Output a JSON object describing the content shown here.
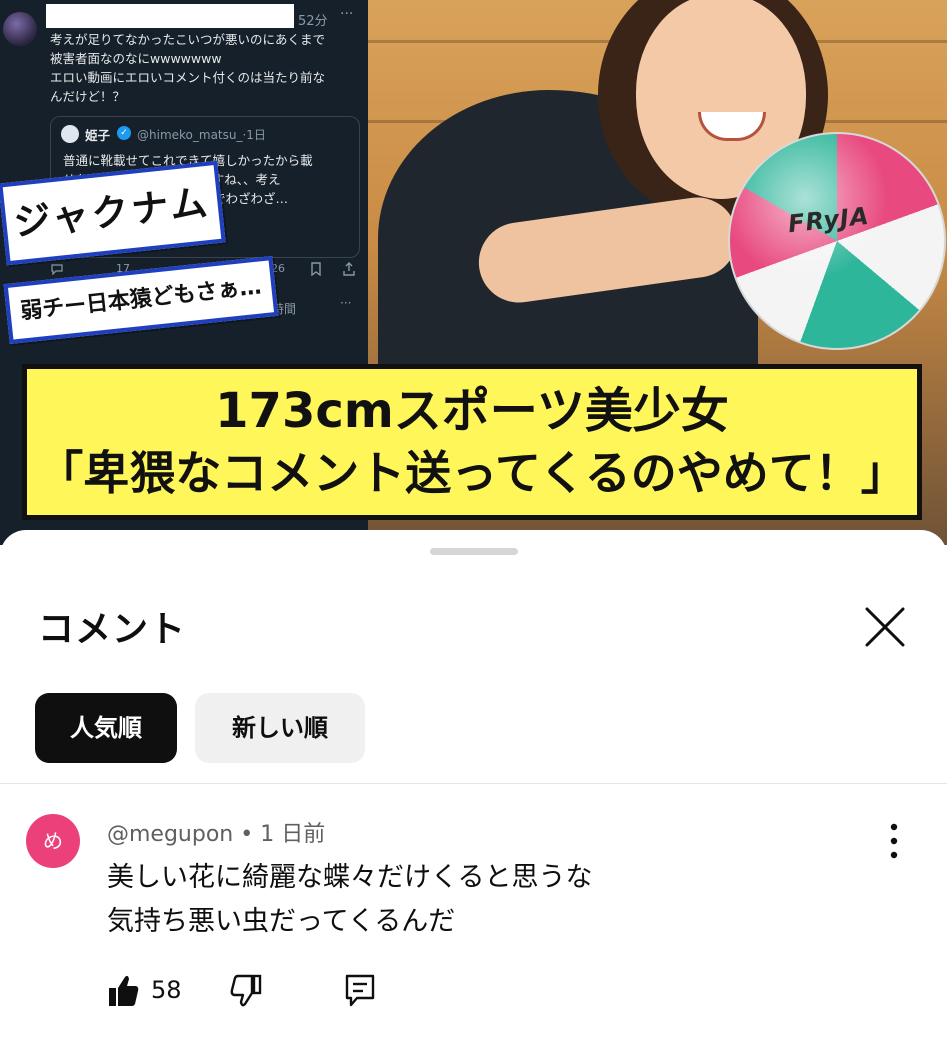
{
  "thumbnail": {
    "tweet": {
      "time": "52分",
      "more": "···",
      "lines": [
        "考えが足りてなかったこいつが悪いのにあくまで",
        "被害者面なのなにwwwwwww",
        "エロい動画にエロいコメント付くのは当たり前な",
        "んだけど！？"
      ],
      "quote": {
        "name": "姫子",
        "handle": "@himeko_matsu_·1日",
        "lines": [
          "普通に靴載せてこれできて嬉しかったから載",
          "せたけど違う…　　ってますね、、考え",
          "",
          "",
          "　　　　　　　　　てるのでわざわざ…"
        ]
      },
      "actions": [
        "17",
        "126"
      ],
      "faded_text": "時間"
    },
    "ball_text": "FRyJA",
    "tag_large": "ジャクナム",
    "tag_small": "弱チー日本猿どもさぁ…",
    "banner_line1": "173cmスポーツ美少女",
    "banner_line2": "「卑猥なコメント送ってくるのやめて！」"
  },
  "sheet": {
    "title": "コメント",
    "chips": [
      "人気順",
      "新しい順"
    ],
    "close_icon": "close-icon"
  },
  "comment": {
    "avatar_letter": "め",
    "avatar_color": "#ec407a",
    "author": "@megupon",
    "time": "1 日前",
    "meta_separator": " • ",
    "lines": [
      "美しい花に綺麗な蝶々だけくると思うな",
      "気持ち悪い虫だってくるんだ"
    ],
    "likes": "58"
  }
}
